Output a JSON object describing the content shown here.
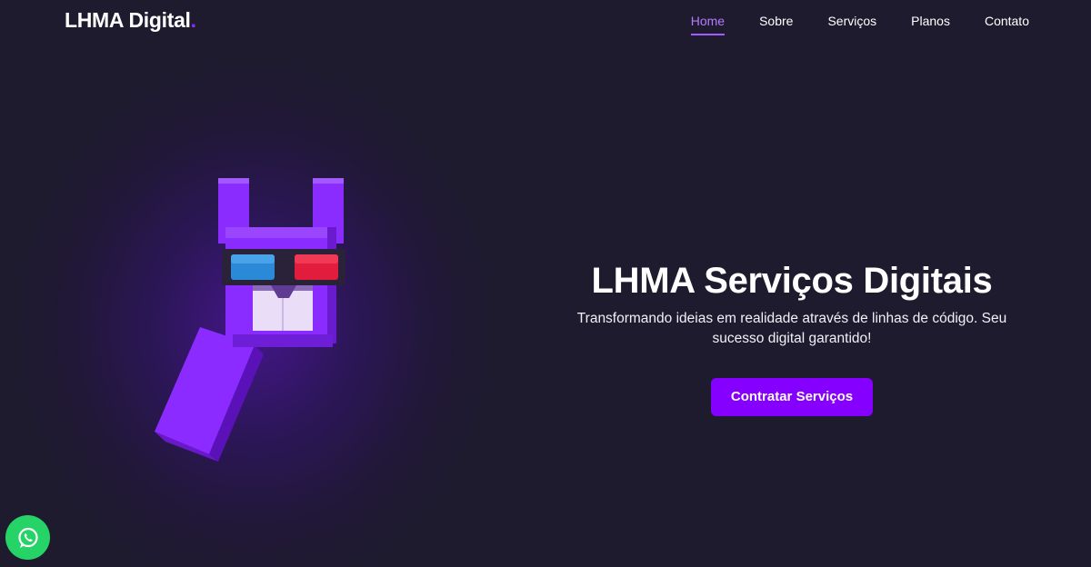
{
  "header": {
    "logo_text": "LHMA Digital",
    "logo_dot": ".",
    "nav": [
      {
        "label": "Home",
        "active": true
      },
      {
        "label": "Sobre",
        "active": false
      },
      {
        "label": "Serviços",
        "active": false
      },
      {
        "label": "Planos",
        "active": false
      },
      {
        "label": "Contato",
        "active": false
      }
    ]
  },
  "hero": {
    "title": "LHMA Serviços Digitais",
    "subtitle": "Transformando ideias em realidade através de linhas de código. Seu sucesso digital garantido!",
    "cta_label": "Contratar Serviços",
    "illustration": "llama-with-3d-glasses"
  },
  "floating": {
    "icon": "whatsapp-icon"
  },
  "colors": {
    "background": "#1e1b2e",
    "accent": "#8500ff",
    "nav_active": "#b57bff",
    "whatsapp": "#25d366"
  }
}
